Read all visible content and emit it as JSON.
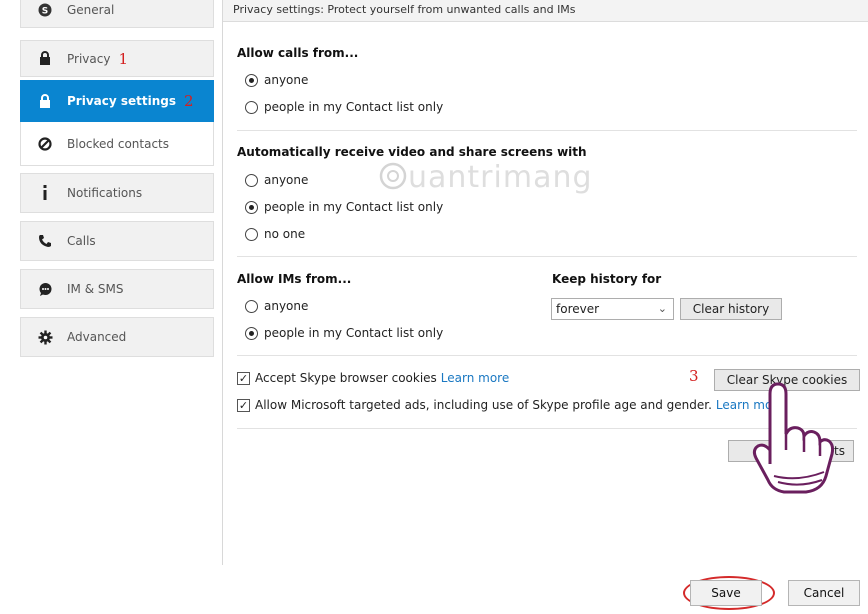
{
  "sidebar": {
    "items": [
      {
        "label": "General",
        "icon": "skype-icon"
      },
      {
        "label": "Privacy",
        "icon": "lock-icon",
        "marker": "1"
      },
      {
        "label": "Privacy settings",
        "icon": "lock-icon",
        "marker": "2",
        "active": true
      },
      {
        "label": "Blocked contacts",
        "icon": "blocked-icon"
      },
      {
        "label": "Notifications",
        "icon": "info-icon"
      },
      {
        "label": "Calls",
        "icon": "phone-icon"
      },
      {
        "label": "IM & SMS",
        "icon": "chat-icon"
      },
      {
        "label": "Advanced",
        "icon": "gear-icon"
      }
    ]
  },
  "panel": {
    "header": "Privacy settings: Protect yourself from unwanted calls and IMs",
    "calls": {
      "title": "Allow calls from...",
      "options": [
        "anyone",
        "people in my Contact list only"
      ],
      "selected": 0
    },
    "video": {
      "title": "Automatically receive video and share screens with",
      "options": [
        "anyone",
        "people in my Contact list only",
        "no one"
      ],
      "selected": 1
    },
    "ims": {
      "title": "Allow IMs from...",
      "options": [
        "anyone",
        "people in my Contact list only"
      ],
      "selected": 1
    },
    "history": {
      "title": "Keep history for",
      "value": "forever",
      "clear_label": "Clear history"
    },
    "cookies": {
      "label": "Accept Skype browser cookies",
      "link": "Learn more",
      "checked": true,
      "marker": "3",
      "button_label": "Clear Skype cookies"
    },
    "ads": {
      "label": "Allow Microsoft targeted ads, including use of Skype profile age and gender.",
      "link": "Learn more",
      "checked": true
    },
    "hidden_button_tail": "cts",
    "watermark": "uantrimang"
  },
  "footer": {
    "save_label": "Save",
    "cancel_label": "Cancel"
  },
  "colors": {
    "accent": "#0a85d0",
    "link": "#1a78c2",
    "annotation": "#d42a2a"
  }
}
